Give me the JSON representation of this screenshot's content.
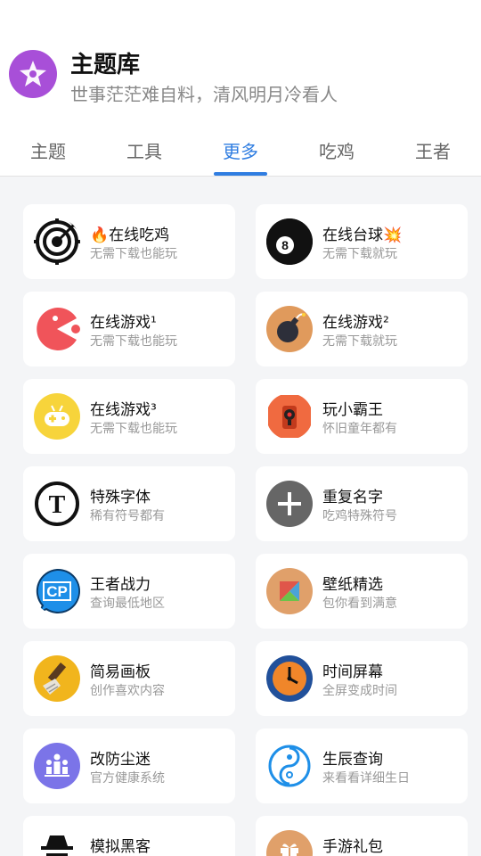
{
  "header": {
    "title": "主题库",
    "subtitle": "世事茫茫难自料，清风明月冷看人"
  },
  "tabs": [
    {
      "label": "主题"
    },
    {
      "label": "工具"
    },
    {
      "label": "更多"
    },
    {
      "label": "吃鸡"
    },
    {
      "label": "王者"
    }
  ],
  "active_tab": "更多",
  "cards": [
    {
      "title": "🔥在线吃鸡",
      "subtitle": "无需下载也能玩",
      "icon": "target-icon"
    },
    {
      "title": "在线台球💥",
      "subtitle": "无需下载就玩",
      "icon": "eight-ball-icon"
    },
    {
      "title": "在线游戏¹",
      "subtitle": "无需下载也能玩",
      "icon": "pacman-icon"
    },
    {
      "title": "在线游戏²",
      "subtitle": "无需下载就玩",
      "icon": "bomb-icon"
    },
    {
      "title": "在线游戏³",
      "subtitle": "无需下载也能玩",
      "icon": "gamepad-icon"
    },
    {
      "title": "玩小霸王",
      "subtitle": "怀旧童年都有",
      "icon": "joystick-icon"
    },
    {
      "title": "特殊字体",
      "subtitle": "稀有符号都有",
      "icon": "font-t-icon"
    },
    {
      "title": "重复名字",
      "subtitle": "吃鸡特殊符号",
      "icon": "plus-icon"
    },
    {
      "title": "王者战力",
      "subtitle": "查询最低地区",
      "icon": "cp-chat-icon"
    },
    {
      "title": "壁纸精选",
      "subtitle": "包你看到满意",
      "icon": "wallpaper-icon"
    },
    {
      "title": "简易画板",
      "subtitle": "创作喜欢内容",
      "icon": "paintbrush-icon"
    },
    {
      "title": "时间屏幕",
      "subtitle": "全屏变成时间",
      "icon": "clock-icon"
    },
    {
      "title": "改防尘迷",
      "subtitle": "官方健康系统",
      "icon": "family-icon"
    },
    {
      "title": "生辰查询",
      "subtitle": "来看看详细生日",
      "icon": "yin-yang-icon"
    },
    {
      "title": "模拟黑客",
      "subtitle": "",
      "icon": "hacker-icon"
    },
    {
      "title": "手游礼包",
      "subtitle": "",
      "icon": "gift-icon"
    }
  ]
}
